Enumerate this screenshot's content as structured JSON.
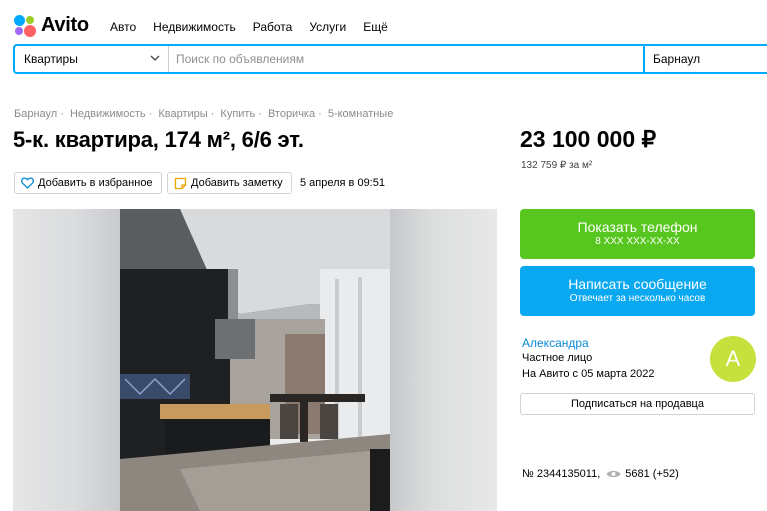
{
  "brand": {
    "name": "Avito",
    "colors": [
      "#00aaff",
      "#97cf26",
      "#ff6163",
      "#a169f7"
    ]
  },
  "nav": {
    "items": [
      "Авто",
      "Недвижимость",
      "Работа",
      "Услуги",
      "Ещё"
    ]
  },
  "search": {
    "category": "Квартиры",
    "placeholder": "Поиск по объявлениям",
    "value": "",
    "city": "Барнаул"
  },
  "breadcrumb": [
    "Барнаул",
    "Недвижимость",
    "Квартиры",
    "Купить",
    "Вторичка",
    "5-комнатные"
  ],
  "listing": {
    "title": "5-к. квартира, 174 м², 6/6 эт.",
    "price": "23 100 000 ₽",
    "price_per_sqm": "132 759 ₽ за м²",
    "favorite_label": "Добавить в избранное",
    "note_label": "Добавить заметку",
    "date": "5 апреля в 09:51",
    "id_text": "№ 2344135011,",
    "views": "5681 (+52)"
  },
  "contact": {
    "phone_label": "Показать телефон",
    "phone_masked": "8 XXX XXX-XX-XX",
    "message_label": "Написать сообщение",
    "message_sub": "Отвечает за несколько часов",
    "accent_green": "#57c61e",
    "accent_blue": "#0aa8f0"
  },
  "seller": {
    "name": "Александра",
    "type": "Частное лицо",
    "since": "На Авито с 05 марта 2022",
    "avatar_letter": "А",
    "subscribe_label": "Подписаться на продавца"
  }
}
